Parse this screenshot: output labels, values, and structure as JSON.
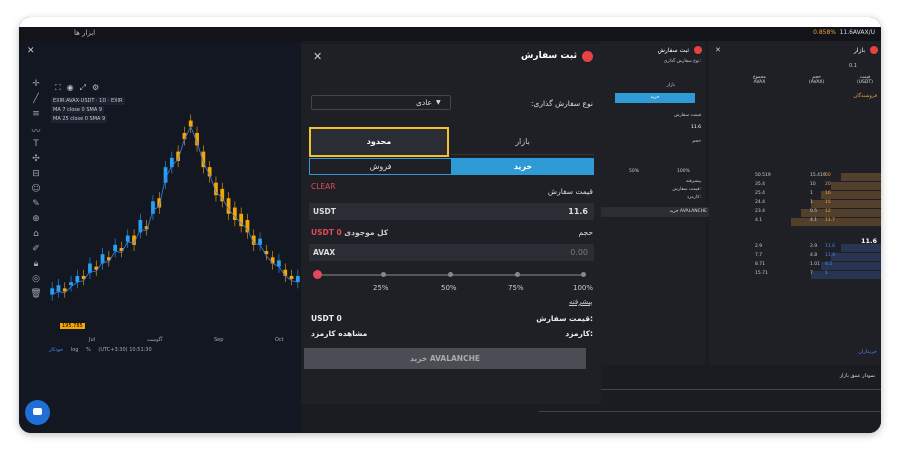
{
  "menubar": {
    "tools_label": "ابزار ها",
    "pair_label": "11.6AVAX/U",
    "pct_label": "0.858%"
  },
  "chart": {
    "legend": [
      "EXIR:AVAX-USDT · 1D · EXIR",
      "MA 7 close 0 SMA 9",
      "MA 25 close 0 SMA 9"
    ],
    "dates": [
      "Jul",
      "آگوست",
      "Sep",
      "Oct"
    ],
    "status": {
      "auto": "خودکار",
      "log": "log",
      "pct": "%",
      "time": "(UTC+3:30) 10:51:30"
    },
    "price_tag": "195.785",
    "candles": [
      [
        14,
        16
      ],
      [
        15,
        17
      ],
      [
        16,
        15
      ],
      [
        17,
        18
      ],
      [
        18,
        20
      ],
      [
        20,
        19
      ],
      [
        21,
        24
      ],
      [
        23,
        22
      ],
      [
        24,
        27
      ],
      [
        26,
        25
      ],
      [
        28,
        30
      ],
      [
        29,
        28
      ],
      [
        31,
        33
      ],
      [
        33,
        30
      ],
      [
        34,
        38
      ],
      [
        36,
        35
      ],
      [
        40,
        44
      ],
      [
        45,
        42
      ],
      [
        50,
        55
      ],
      [
        55,
        58
      ],
      [
        60,
        57
      ],
      [
        66,
        64
      ],
      [
        70,
        68
      ],
      [
        66,
        62
      ],
      [
        60,
        55
      ],
      [
        55,
        52
      ],
      [
        50,
        46
      ],
      [
        48,
        44
      ],
      [
        45,
        40
      ],
      [
        42,
        38
      ],
      [
        40,
        36
      ],
      [
        38,
        34
      ],
      [
        33,
        30
      ],
      [
        30,
        32
      ],
      [
        28,
        27
      ],
      [
        26,
        24
      ],
      [
        23,
        25
      ],
      [
        22,
        20
      ],
      [
        20,
        19
      ],
      [
        18,
        20
      ]
    ]
  },
  "order": {
    "title": "ثبت سفارش",
    "order_type_label": "نوع سفارش گذاری:",
    "order_type_value": "عادی",
    "tab_limit": "محدود",
    "tab_market": "بازار",
    "tab_sell": "فروش",
    "tab_buy": "خرید",
    "clear": "CLEAR",
    "price_label": "قیمت سفارش",
    "price_unit": "USDT",
    "price_value": "11.6",
    "volume_label": "حجم",
    "balance_label": "کل موجودی",
    "balance_value": "USDT 0",
    "volume_unit": "AVAX",
    "volume_value": "0.00",
    "slider_value_pct": 0,
    "slider_marks": [
      "25%",
      "50%",
      "75%",
      "100%"
    ],
    "advanced": "پیشرفته",
    "summary_label": "قیمت سفارش:",
    "summary_value": "USDT 0",
    "fee_label": "کارمزد:",
    "fee_link": "مشاهده کارمزد",
    "buy_button": "خرید AVALANCHE"
  },
  "mid_panel": {
    "title": "ثبت سفارش",
    "order_type": "نوع سفارش گذاری:",
    "market": "بازار",
    "buy": "خرید",
    "price_label": "قیمت سفارش",
    "price_value": "11.6",
    "volume": "حجم",
    "pcts": [
      "50%",
      "100%"
    ],
    "advanced": "پیشرفته",
    "summary": "قیمت سفارش:",
    "fee": "کارمزد:",
    "buy_btn": "خرید AVALANCHE"
  },
  "book": {
    "title": "بازار",
    "tick": "0.1",
    "col_total": "مجموع",
    "col_total_unit": "AVAX",
    "col_volume": "حجم",
    "col_volume_unit": "(AVAX)",
    "col_price": "قیمت",
    "col_price_unit": "(USDT)",
    "sellers": "فروشندگان",
    "buyers": "خریداران",
    "mid_price": "11.6",
    "asks": [
      [
        "50.519",
        "15.419",
        "50"
      ],
      [
        "35.4",
        "10",
        "20"
      ],
      [
        "25.4",
        "1",
        "16"
      ],
      [
        "24.4",
        "1",
        "15"
      ],
      [
        "23.4",
        "0.5",
        "12"
      ],
      [
        "4.1",
        "4.1",
        "11.7"
      ]
    ],
    "bids": [
      [
        "2.9",
        "2.9",
        "11.6"
      ],
      [
        "7.7",
        "4.8",
        "11.4"
      ],
      [
        "8.71",
        "1.01",
        "8.5"
      ],
      [
        "15.71",
        "7",
        "1"
      ]
    ],
    "depth_title": "نمودار عمق بازار"
  }
}
